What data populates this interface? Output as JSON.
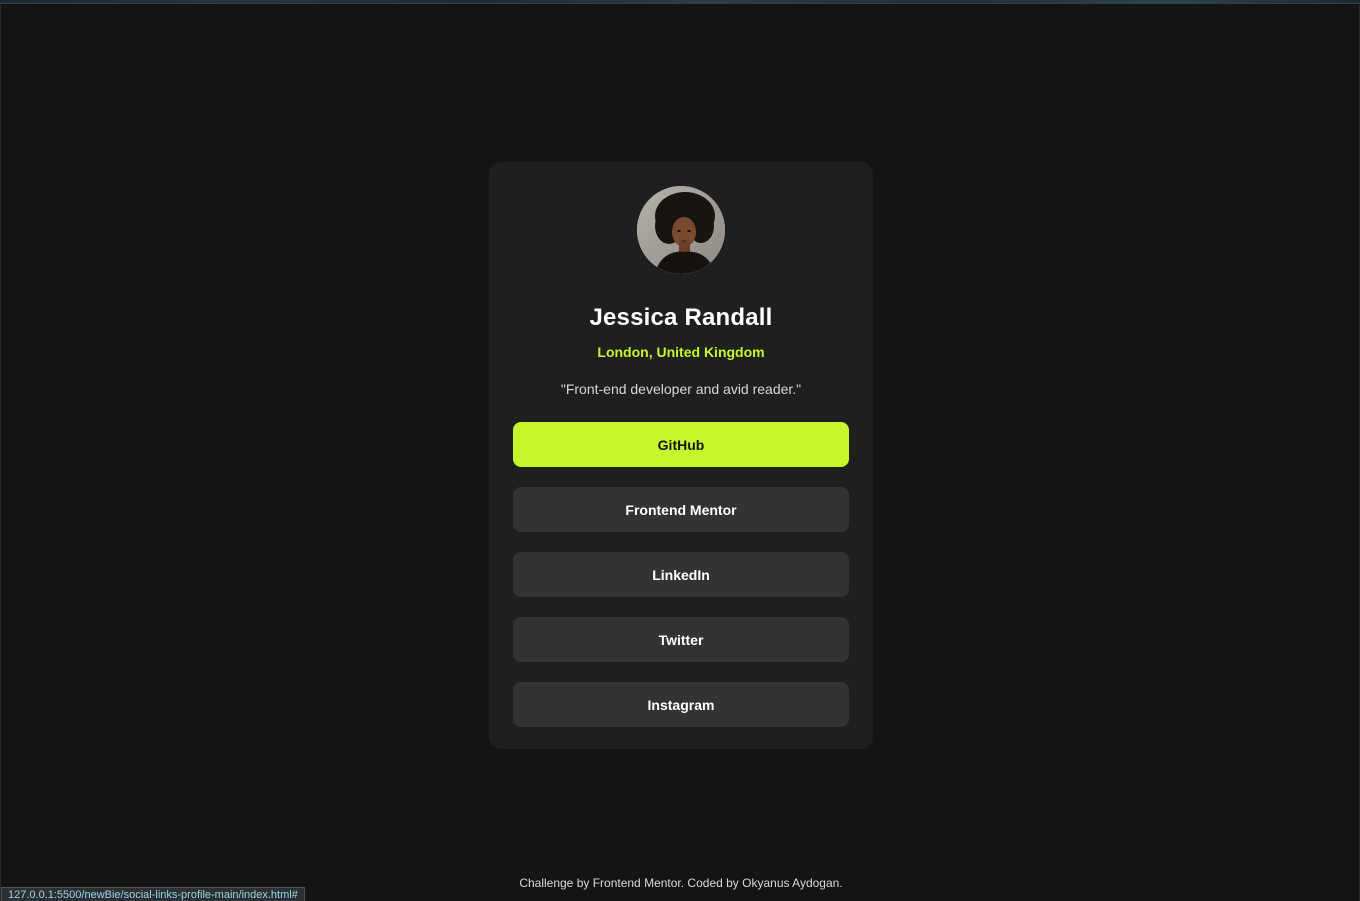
{
  "profile": {
    "avatar_icon": "profile-photo-avatar",
    "name": "Jessica Randall",
    "location": "London, United Kingdom",
    "bio": "\"Front-end developer and avid reader.\""
  },
  "links": [
    {
      "label": "GitHub",
      "active": true
    },
    {
      "label": "Frontend Mentor",
      "active": false
    },
    {
      "label": "LinkedIn",
      "active": false
    },
    {
      "label": "Twitter",
      "active": false
    },
    {
      "label": "Instagram",
      "active": false
    }
  ],
  "footer": {
    "prefix": "Challenge by ",
    "challenge_link": "Frontend Mentor",
    "middle": ". Coded by ",
    "author": "Okyanus Aydogan",
    "suffix": "."
  },
  "status_bar": {
    "url": "127.0.0.1:5500/newBie/social-links-profile-main/index.html#"
  },
  "colors": {
    "background": "#141414",
    "card": "#1f1f1f",
    "button": "#333333",
    "accent": "#c4f82a",
    "text": "#ffffff"
  }
}
